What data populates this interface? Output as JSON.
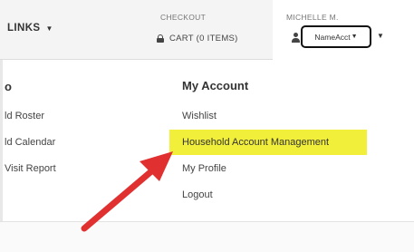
{
  "header": {
    "links_label": "LINKS",
    "checkout_label": "CHECKOUT",
    "cart_label": "CART (0 ITEMS)",
    "user_name": "MICHELLE M.",
    "account_select_value": "NameAcct"
  },
  "left_column": {
    "heading_fragment": "o",
    "items": [
      "ld Roster",
      "ld Calendar",
      "Visit Report"
    ]
  },
  "account_menu": {
    "heading": "My Account",
    "items": [
      "Wishlist",
      "Household Account Management",
      "My Profile",
      "Logout"
    ],
    "highlighted_item": "Household Account Management"
  },
  "colors": {
    "highlight": "#f2ef3a",
    "arrow": "#e03030",
    "select_border": "#111111"
  },
  "icons": {
    "cart": "lock-icon",
    "user": "user-icon",
    "dropdown": "caret-down-icon",
    "annotation": "arrow-icon"
  }
}
